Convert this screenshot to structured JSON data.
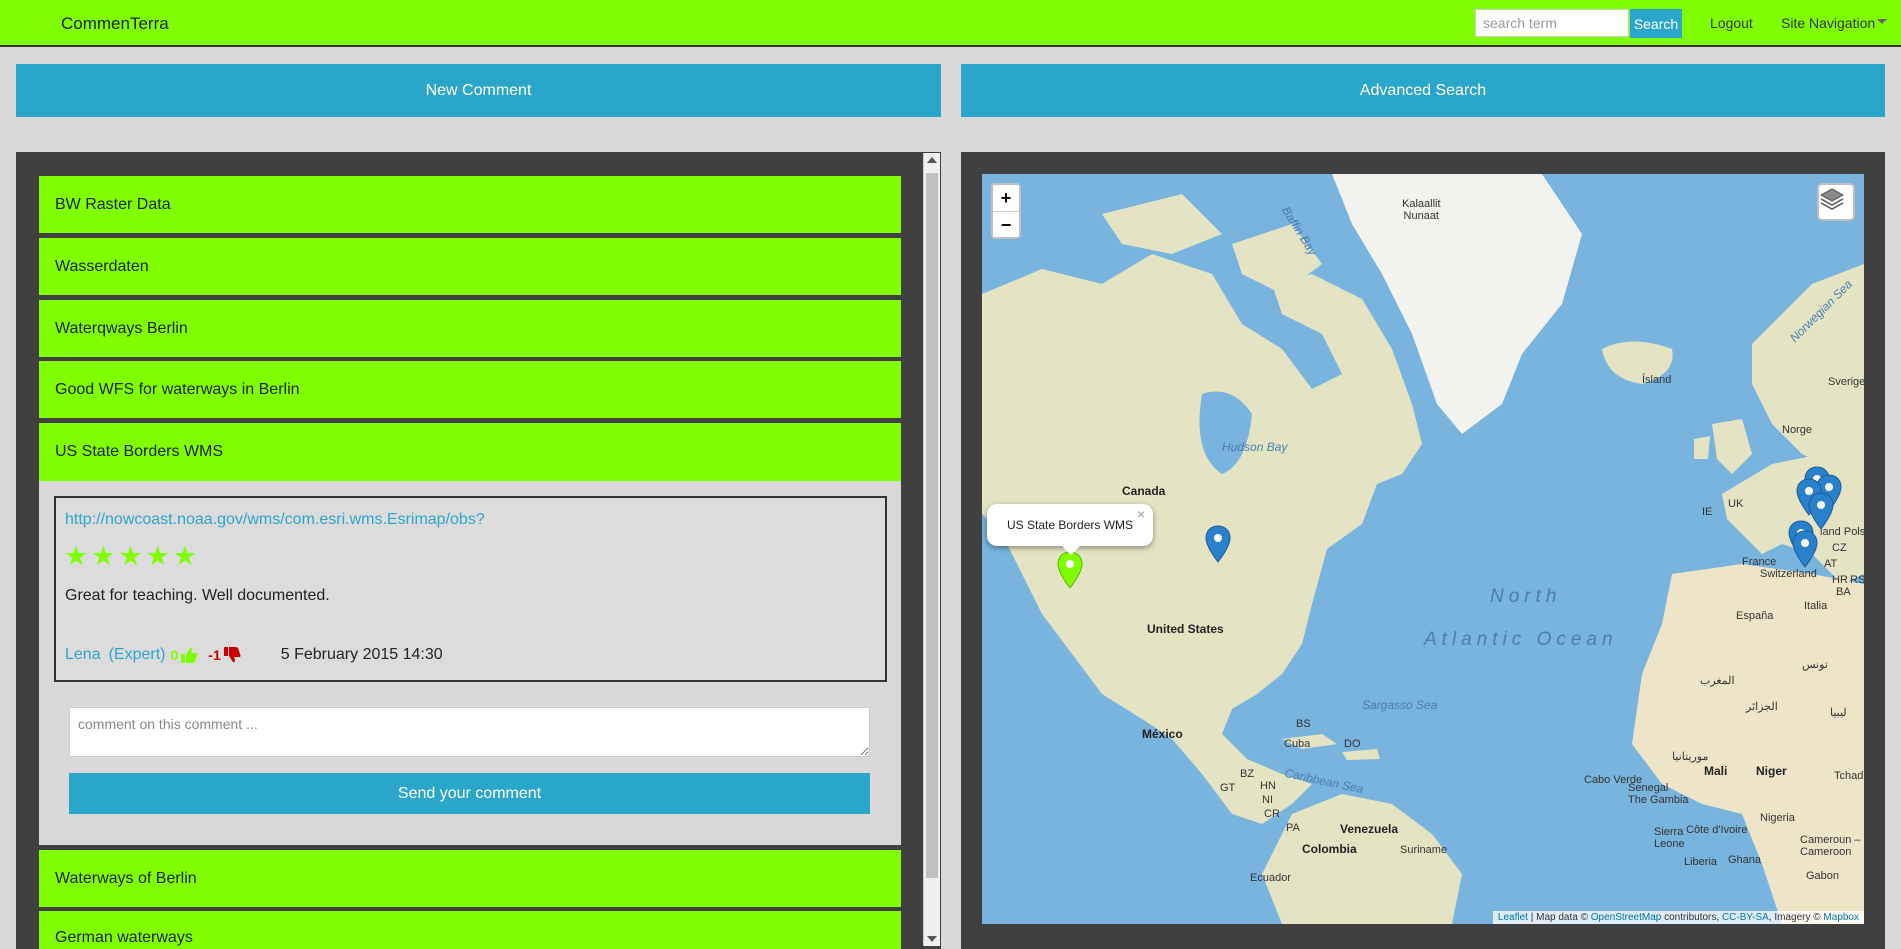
{
  "header": {
    "brand": "CommenTerra",
    "search_placeholder": "search term",
    "search_button": "Search",
    "logout": "Logout",
    "site_navigation": "Site Navigation"
  },
  "actions": {
    "new_comment": "New Comment",
    "advanced_search": "Advanced Search"
  },
  "accordion": {
    "items": [
      {
        "label": "BW Raster Data"
      },
      {
        "label": "Wasserdaten"
      },
      {
        "label": "Waterqways Berlin"
      },
      {
        "label": "Good WFS for waterways in Berlin"
      },
      {
        "label": "US State Borders WMS"
      },
      {
        "label": "Waterways of Berlin"
      },
      {
        "label": "German waterways"
      }
    ],
    "expanded": {
      "url": "http://nowcoast.noaa.gov/wms/com.esri.wms.Esrimap/obs?",
      "rating": 5,
      "stars": "★",
      "text": "Great for teaching. Well documented.",
      "author": "Lena",
      "author_role": "(Expert)",
      "upvotes": "0",
      "downvotes": "-1",
      "date": "5 February 2015 14:30",
      "reply_placeholder": "comment on this comment ...",
      "send_button": "Send your comment"
    }
  },
  "map": {
    "zoom_in": "+",
    "zoom_out": "−",
    "popup_title": "US State Borders WMS",
    "popup_close": "×",
    "labels": {
      "greenland": "Kalaallit\nNunaat",
      "baffin_bay": "Baffin Bay",
      "hudson_bay": "Hudson Bay",
      "canada": "Canada",
      "united_states": "United States",
      "mexico": "México",
      "north": "North",
      "atlantic_ocean": "Atlantic Ocean",
      "sargasso_sea": "Sargasso Sea",
      "caribbean_sea": "Caribbean Sea",
      "island": "Ísland",
      "norwegian_sea": "Norwegian Sea",
      "norge": "Norge",
      "sverige": "Sverige",
      "uk": "UK",
      "ie": "IE",
      "france": "France",
      "espana": "España",
      "switzerland": "Switzerland",
      "italia": "Italia",
      "cuba": "Cuba",
      "bs": "BS",
      "do": "DO",
      "venezuela": "Venezuela",
      "colombia": "Colombia",
      "suriname": "Suriname",
      "ecuador": "Ecuador",
      "mali": "Mali",
      "niger": "Niger",
      "nigeria": "Nigeria",
      "cabo_verde": "Cabo Verde",
      "senegal": "Senegal\nThe Gambia",
      "sierra_leone": "Sierra\nLeone",
      "liberia": "Liberia",
      "cote_divoire": "Côte d'Ivoire",
      "ghana": "Ghana",
      "cameroun": "Cameroun –\nCameroon",
      "gabon": "Gabon",
      "tchad": "Tchad",
      "cz": "CZ",
      "at": "AT",
      "hr": "HR",
      "ba": "BA",
      "rs": "RS",
      "polska": "land Polsk",
      "gt": "GT",
      "bz": "BZ",
      "hn": "HN",
      "ni": "NI",
      "cr": "CR",
      "pa": "PA",
      "pais_morocco": "المغرب",
      "algeria": "الجزائر",
      "libya": "ليبيا",
      "mauritania": "موريتانيا",
      "tunisia": "تونس"
    },
    "attribution": {
      "leaflet": "Leaflet",
      "map_data": " | Map data © ",
      "osm": "OpenStreetMap",
      "contributors": " contributors, ",
      "license": "CC-BY-SA",
      "imagery": ", Imagery © ",
      "mapbox": "Mapbox"
    },
    "colors": {
      "water": "#78b4de",
      "land": "#e6e2c2",
      "marker_blue": "#2a81cb",
      "marker_green": "#80ff00"
    }
  }
}
